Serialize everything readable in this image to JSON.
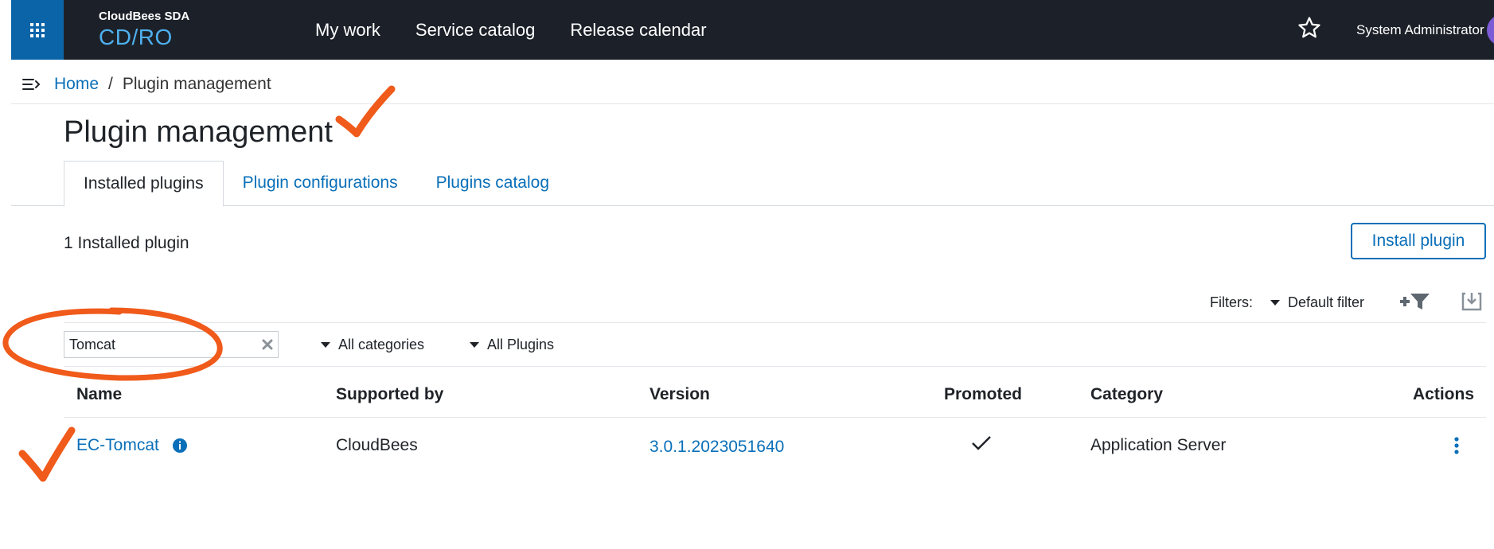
{
  "header": {
    "brand_sub": "CloudBees SDA",
    "brand_main": "CD/RO",
    "nav": [
      "My work",
      "Service catalog",
      "Release calendar"
    ],
    "user": "System Administrator"
  },
  "breadcrumb": {
    "home": "Home",
    "separator": "/",
    "current": "Plugin management"
  },
  "page": {
    "title": "Plugin management"
  },
  "tabs": [
    "Installed plugins",
    "Plugin configurations",
    "Plugins catalog"
  ],
  "summary": {
    "count_text": "1 Installed plugin",
    "install_button": "Install plugin"
  },
  "filters": {
    "label": "Filters:",
    "default": "Default filter"
  },
  "search": {
    "value": "Tomcat"
  },
  "dropdowns": {
    "categories": "All categories",
    "plugins": "All Plugins"
  },
  "table": {
    "columns": [
      "Name",
      "Supported by",
      "Version",
      "Promoted",
      "Category",
      "Actions"
    ],
    "rows": [
      {
        "name": "EC-Tomcat",
        "supported_by": "CloudBees",
        "version": "3.0.1.2023051640",
        "promoted": true,
        "category": "Application Server"
      }
    ]
  },
  "colors": {
    "accent": "#0a6fb8",
    "topbar": "#1c2129",
    "annotation": "#f05a1a"
  },
  "icons": [
    "apps-grid-icon",
    "star-icon",
    "sidebar-toggle-icon",
    "add-filter-icon",
    "export-icon",
    "clear-icon",
    "info-icon",
    "check-icon",
    "kebab-menu-icon"
  ]
}
